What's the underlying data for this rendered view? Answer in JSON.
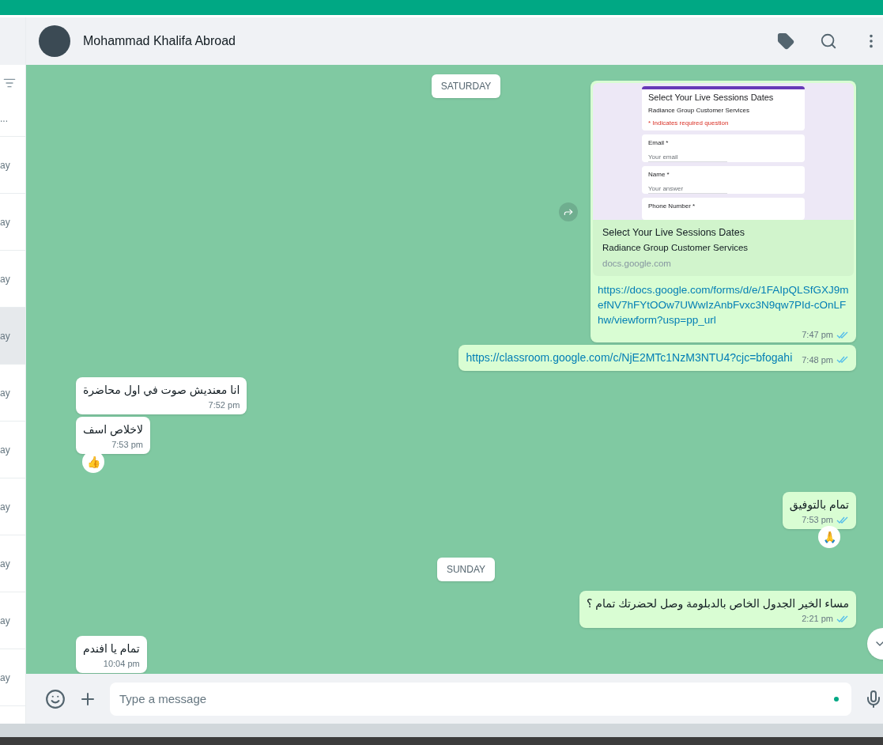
{
  "sidebar": {
    "items": [
      {
        "text": "...",
        "selected": false
      },
      {
        "text": "ay",
        "selected": false
      },
      {
        "text": "ay",
        "selected": false
      },
      {
        "text": "ay",
        "selected": false
      },
      {
        "text": "ay",
        "selected": true
      },
      {
        "text": "ay",
        "selected": false
      },
      {
        "text": "ay",
        "selected": false
      },
      {
        "text": "ay",
        "selected": false
      },
      {
        "text": "ay",
        "selected": false
      },
      {
        "text": "ay",
        "selected": false
      },
      {
        "text": "ay",
        "selected": false
      }
    ]
  },
  "header": {
    "contact_name": "Mohammad Khalifa Abroad"
  },
  "messages": [
    {
      "kind": "date",
      "text": "SATURDAY"
    },
    {
      "kind": "link_preview",
      "outgoing": true,
      "preview": {
        "form_title": "Select Your Live Sessions Dates",
        "form_subtitle": "Radiance Group Customer Services",
        "required_note": "* Indicates required question",
        "fields": [
          {
            "label": "Email *",
            "placeholder": "Your email"
          },
          {
            "label": "Name *",
            "placeholder": "Your answer"
          },
          {
            "label": "Phone Number *"
          }
        ],
        "title": "Select Your Live Sessions Dates",
        "description": "Radiance Group Customer Services",
        "domain": "docs.google.com"
      },
      "text": "https://docs.google.com/forms/d/e/1FAIpQLSfGXJ9mefNV7hFYtOOw7UWwIzAnbFvxc3N9qw7PId-cOnLFhw/viewform?usp=pp_url",
      "time": "7:47 pm",
      "read": true
    },
    {
      "kind": "link",
      "outgoing": true,
      "text": "https://classroom.google.com/c/NjE2MTc1NzM3NTU4?cjc=bfogahi",
      "time": "7:48 pm",
      "read": true
    },
    {
      "kind": "text",
      "outgoing": false,
      "text": "انا معنديش صوت في اول محاضرة",
      "time": "7:52 pm"
    },
    {
      "kind": "text",
      "outgoing": false,
      "text": "لاخلاص اسف",
      "time": "7:53 pm",
      "reaction": "👍"
    },
    {
      "kind": "text",
      "outgoing": true,
      "text": "تمام بالتوفيق",
      "time": "7:53 pm",
      "read": true,
      "reaction": "🙏"
    },
    {
      "kind": "date",
      "text": "SUNDAY"
    },
    {
      "kind": "text",
      "outgoing": true,
      "text": "مساء الخير الجدول الخاص بالدبلومة وصل لحضرتك تمام ؟",
      "time": "2:21 pm",
      "read": true
    },
    {
      "kind": "text",
      "outgoing": false,
      "text": "تمام يا افندم",
      "time": "10:04 pm"
    }
  ],
  "composer": {
    "placeholder": "Type a message"
  }
}
